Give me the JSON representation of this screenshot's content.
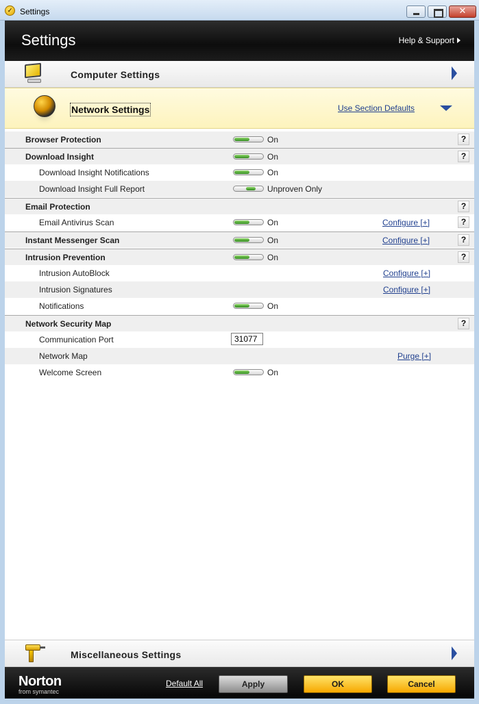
{
  "window": {
    "title": "Settings"
  },
  "header": {
    "title": "Settings",
    "help_link": "Help & Support"
  },
  "sections": {
    "computer": {
      "label": "Computer Settings"
    },
    "network": {
      "label": "Network Settings",
      "defaults_link": "Use Section Defaults"
    },
    "misc": {
      "label": "Miscellaneous Settings"
    }
  },
  "rows": [
    {
      "name": "Browser Protection",
      "state": "On",
      "action": "",
      "help": "?"
    },
    {
      "name": "Download Insight",
      "state": "On",
      "action": "",
      "help": "?"
    },
    {
      "name": "Download Insight Notifications",
      "state": "On",
      "action": "",
      "help": ""
    },
    {
      "name": "Download Insight Full Report",
      "state": "Unproven Only",
      "action": "",
      "help": ""
    },
    {
      "name": "Email Protection",
      "state": "",
      "action": "",
      "help": "?"
    },
    {
      "name": "Email Antivirus Scan",
      "state": "On",
      "action": "Configure [+]",
      "help": "?"
    },
    {
      "name": "Instant Messenger Scan",
      "state": "On",
      "action": "Configure [+]",
      "help": "?"
    },
    {
      "name": "Intrusion Prevention",
      "state": "On",
      "action": "",
      "help": "?"
    },
    {
      "name": "Intrusion AutoBlock",
      "state": "",
      "action": "Configure [+]",
      "help": ""
    },
    {
      "name": "Intrusion Signatures",
      "state": "",
      "action": "Configure [+]",
      "help": ""
    },
    {
      "name": "Notifications",
      "state": "On",
      "action": "",
      "help": ""
    },
    {
      "name": "Network Security Map",
      "state": "",
      "action": "",
      "help": "?"
    },
    {
      "name": "Communication Port",
      "value": "31077",
      "action": "",
      "help": ""
    },
    {
      "name": "Network Map",
      "state": "",
      "action": "Purge [+]",
      "help": ""
    },
    {
      "name": "Welcome Screen",
      "state": "On",
      "action": "",
      "help": ""
    }
  ],
  "footer": {
    "brand": "Norton",
    "brand_sub": "from symantec",
    "default_all": "Default All",
    "apply": "Apply",
    "ok": "OK",
    "cancel": "Cancel"
  },
  "icons": {
    "app": "norton-shield-icon",
    "computer": "monitor-icon",
    "network": "globe-icon",
    "misc": "drill-icon",
    "expand": "chevron-right-icon",
    "collapse": "chevron-down-icon"
  }
}
